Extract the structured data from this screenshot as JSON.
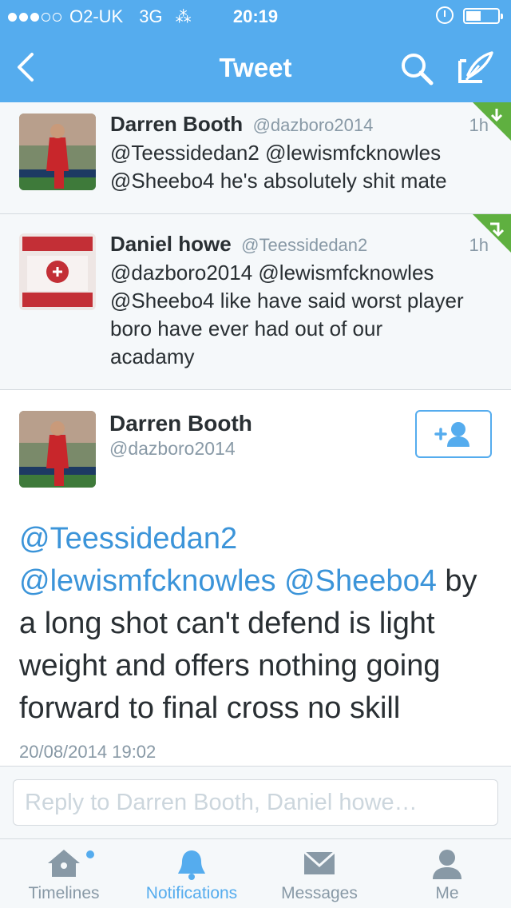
{
  "status_bar": {
    "carrier": "O2-UK",
    "network": "3G",
    "time": "20:19"
  },
  "nav": {
    "title": "Tweet",
    "icons": [
      "back-chevron-icon",
      "search-icon",
      "compose-icon"
    ]
  },
  "replies": [
    {
      "name": "Darren Booth",
      "handle": "@dazboro2014",
      "time": "1h",
      "text_lines": [
        "@Teessidedan2 @lewismfcknowles",
        "@Sheebo4 he's absolutely shit mate"
      ],
      "corner_color": "#5fb040"
    },
    {
      "name": "Daniel howe",
      "handle": "@Teessidedan2",
      "time": "1h",
      "text_lines": [
        "@dazboro2014 @lewismfcknowles",
        "@Sheebo4 like have said worst player",
        "boro have ever had out of our",
        "acadamy"
      ],
      "corner_color": "#5fb040"
    }
  ],
  "focused_tweet": {
    "name": "Darren Booth",
    "handle": "@dazboro2014",
    "mention1": "@Teessidedan2",
    "mention2": "@lewismfcknowles",
    "mention3": "@Sheebo4",
    "text_line2_rest": " by",
    "text_line3": "a long shot can't defend is light",
    "text_line4": "weight and offers nothing going",
    "text_line5": "forward to final cross no skill",
    "date": "20/08/2014 19:02"
  },
  "reply_box": {
    "placeholder": "Reply to Darren Booth, Daniel howe…"
  },
  "tabs": [
    {
      "label": "Timelines",
      "icon": "home-icon",
      "active": false
    },
    {
      "label": "Notifications",
      "icon": "bell-icon",
      "active": true
    },
    {
      "label": "Messages",
      "icon": "envelope-icon",
      "active": false
    },
    {
      "label": "Me",
      "icon": "person-icon",
      "active": false
    }
  ],
  "colors": {
    "brand_blue": "#55acee",
    "link_blue": "#3b94d9",
    "muted_gray": "#8899a6",
    "text_dark": "#292f33",
    "conversation_green": "#5fb040"
  }
}
